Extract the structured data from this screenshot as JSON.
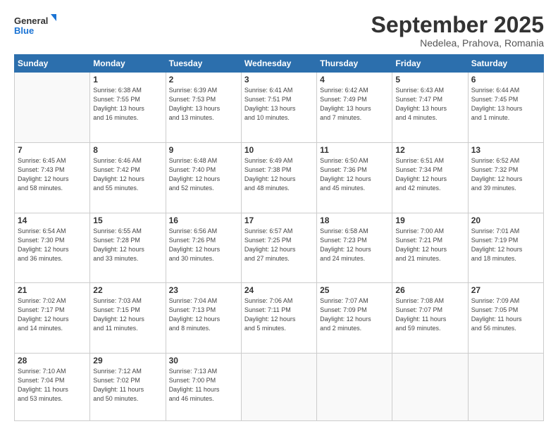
{
  "logo": {
    "line1": "General",
    "line2": "Blue"
  },
  "title": "September 2025",
  "location": "Nedelea, Prahova, Romania",
  "weekdays": [
    "Sunday",
    "Monday",
    "Tuesday",
    "Wednesday",
    "Thursday",
    "Friday",
    "Saturday"
  ],
  "weeks": [
    [
      {
        "day": "",
        "info": ""
      },
      {
        "day": "1",
        "info": "Sunrise: 6:38 AM\nSunset: 7:55 PM\nDaylight: 13 hours\nand 16 minutes."
      },
      {
        "day": "2",
        "info": "Sunrise: 6:39 AM\nSunset: 7:53 PM\nDaylight: 13 hours\nand 13 minutes."
      },
      {
        "day": "3",
        "info": "Sunrise: 6:41 AM\nSunset: 7:51 PM\nDaylight: 13 hours\nand 10 minutes."
      },
      {
        "day": "4",
        "info": "Sunrise: 6:42 AM\nSunset: 7:49 PM\nDaylight: 13 hours\nand 7 minutes."
      },
      {
        "day": "5",
        "info": "Sunrise: 6:43 AM\nSunset: 7:47 PM\nDaylight: 13 hours\nand 4 minutes."
      },
      {
        "day": "6",
        "info": "Sunrise: 6:44 AM\nSunset: 7:45 PM\nDaylight: 13 hours\nand 1 minute."
      }
    ],
    [
      {
        "day": "7",
        "info": "Sunrise: 6:45 AM\nSunset: 7:43 PM\nDaylight: 12 hours\nand 58 minutes."
      },
      {
        "day": "8",
        "info": "Sunrise: 6:46 AM\nSunset: 7:42 PM\nDaylight: 12 hours\nand 55 minutes."
      },
      {
        "day": "9",
        "info": "Sunrise: 6:48 AM\nSunset: 7:40 PM\nDaylight: 12 hours\nand 52 minutes."
      },
      {
        "day": "10",
        "info": "Sunrise: 6:49 AM\nSunset: 7:38 PM\nDaylight: 12 hours\nand 48 minutes."
      },
      {
        "day": "11",
        "info": "Sunrise: 6:50 AM\nSunset: 7:36 PM\nDaylight: 12 hours\nand 45 minutes."
      },
      {
        "day": "12",
        "info": "Sunrise: 6:51 AM\nSunset: 7:34 PM\nDaylight: 12 hours\nand 42 minutes."
      },
      {
        "day": "13",
        "info": "Sunrise: 6:52 AM\nSunset: 7:32 PM\nDaylight: 12 hours\nand 39 minutes."
      }
    ],
    [
      {
        "day": "14",
        "info": "Sunrise: 6:54 AM\nSunset: 7:30 PM\nDaylight: 12 hours\nand 36 minutes."
      },
      {
        "day": "15",
        "info": "Sunrise: 6:55 AM\nSunset: 7:28 PM\nDaylight: 12 hours\nand 33 minutes."
      },
      {
        "day": "16",
        "info": "Sunrise: 6:56 AM\nSunset: 7:26 PM\nDaylight: 12 hours\nand 30 minutes."
      },
      {
        "day": "17",
        "info": "Sunrise: 6:57 AM\nSunset: 7:25 PM\nDaylight: 12 hours\nand 27 minutes."
      },
      {
        "day": "18",
        "info": "Sunrise: 6:58 AM\nSunset: 7:23 PM\nDaylight: 12 hours\nand 24 minutes."
      },
      {
        "day": "19",
        "info": "Sunrise: 7:00 AM\nSunset: 7:21 PM\nDaylight: 12 hours\nand 21 minutes."
      },
      {
        "day": "20",
        "info": "Sunrise: 7:01 AM\nSunset: 7:19 PM\nDaylight: 12 hours\nand 18 minutes."
      }
    ],
    [
      {
        "day": "21",
        "info": "Sunrise: 7:02 AM\nSunset: 7:17 PM\nDaylight: 12 hours\nand 14 minutes."
      },
      {
        "day": "22",
        "info": "Sunrise: 7:03 AM\nSunset: 7:15 PM\nDaylight: 12 hours\nand 11 minutes."
      },
      {
        "day": "23",
        "info": "Sunrise: 7:04 AM\nSunset: 7:13 PM\nDaylight: 12 hours\nand 8 minutes."
      },
      {
        "day": "24",
        "info": "Sunrise: 7:06 AM\nSunset: 7:11 PM\nDaylight: 12 hours\nand 5 minutes."
      },
      {
        "day": "25",
        "info": "Sunrise: 7:07 AM\nSunset: 7:09 PM\nDaylight: 12 hours\nand 2 minutes."
      },
      {
        "day": "26",
        "info": "Sunrise: 7:08 AM\nSunset: 7:07 PM\nDaylight: 11 hours\nand 59 minutes."
      },
      {
        "day": "27",
        "info": "Sunrise: 7:09 AM\nSunset: 7:05 PM\nDaylight: 11 hours\nand 56 minutes."
      }
    ],
    [
      {
        "day": "28",
        "info": "Sunrise: 7:10 AM\nSunset: 7:04 PM\nDaylight: 11 hours\nand 53 minutes."
      },
      {
        "day": "29",
        "info": "Sunrise: 7:12 AM\nSunset: 7:02 PM\nDaylight: 11 hours\nand 50 minutes."
      },
      {
        "day": "30",
        "info": "Sunrise: 7:13 AM\nSunset: 7:00 PM\nDaylight: 11 hours\nand 46 minutes."
      },
      {
        "day": "",
        "info": ""
      },
      {
        "day": "",
        "info": ""
      },
      {
        "day": "",
        "info": ""
      },
      {
        "day": "",
        "info": ""
      }
    ]
  ]
}
